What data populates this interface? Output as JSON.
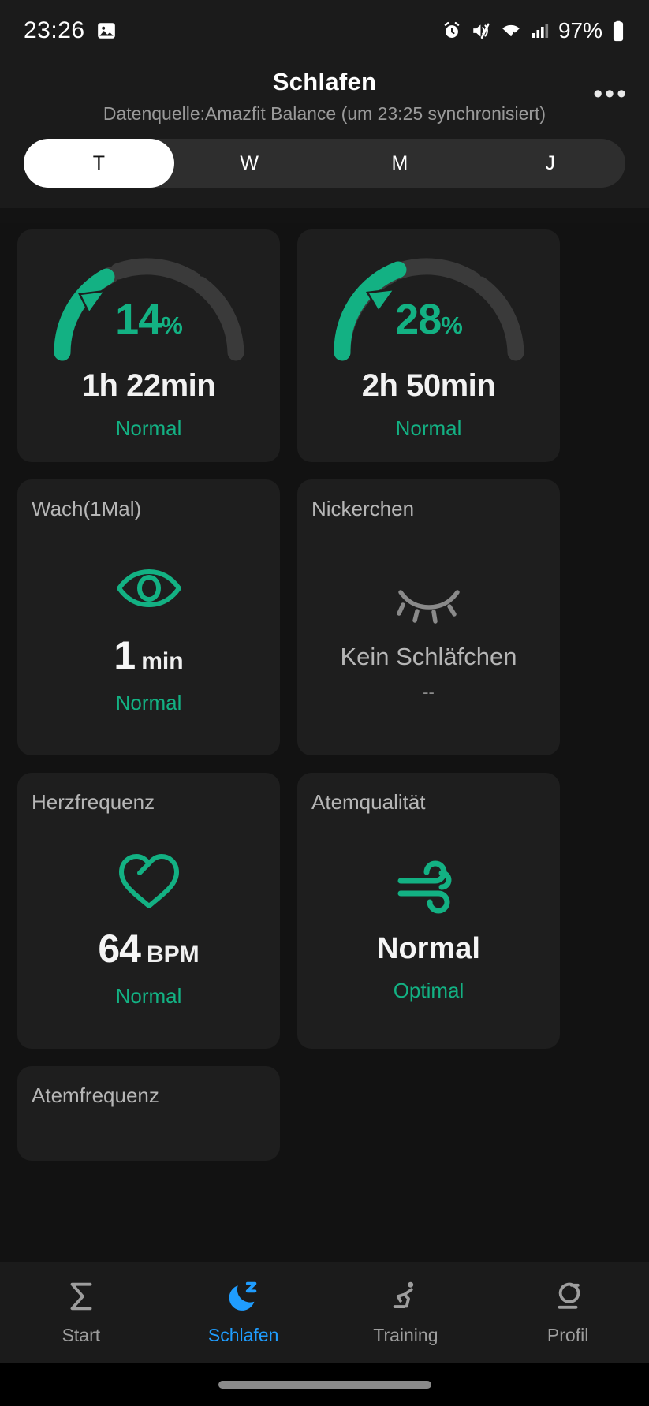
{
  "status_bar": {
    "time": "23:26",
    "battery_percent": "97%",
    "icons": [
      "image-icon",
      "alarm-icon",
      "mute-icon",
      "wifi-icon",
      "signal-icon",
      "battery-icon"
    ]
  },
  "header": {
    "title": "Schlafen",
    "subtitle": "Datenquelle:Amazfit Balance (um 23:25 synchronisiert)",
    "more_label": "•••"
  },
  "period_tabs": {
    "items": [
      {
        "label": "T",
        "active": true
      },
      {
        "label": "W",
        "active": false
      },
      {
        "label": "M",
        "active": false
      },
      {
        "label": "J",
        "active": false
      }
    ]
  },
  "colors": {
    "accent_green": "#13b183",
    "accent_blue": "#1f9dff",
    "card_bg": "#1e1e1e",
    "track_gray": "#3a3a3a"
  },
  "cards": {
    "deep_sleep": {
      "percent": "14",
      "percent_unit": "%",
      "percent_value": 14,
      "duration": "1h 22min",
      "status": "Normal"
    },
    "light_sleep": {
      "percent": "28",
      "percent_unit": "%",
      "percent_value": 28,
      "duration": "2h 50min",
      "status": "Normal"
    },
    "awake": {
      "title": "Wach(1Mal)",
      "icon": "eye-open-icon",
      "value": "1",
      "unit": "min",
      "status": "Normal"
    },
    "nap": {
      "title": "Nickerchen",
      "icon": "eye-closed-icon",
      "value": "Kein Schläfchen",
      "status": "--"
    },
    "heart_rate": {
      "title": "Herzfrequenz",
      "icon": "heart-icon",
      "value": "64",
      "unit": "BPM",
      "status": "Normal"
    },
    "breathing_quality": {
      "title": "Atemqualität",
      "icon": "wind-icon",
      "value": "Normal",
      "status": "Optimal"
    },
    "breathing_rate": {
      "title": "Atemfrequenz"
    }
  },
  "bottom_nav": {
    "items": [
      {
        "label": "Start",
        "icon": "sigma-icon",
        "active": false
      },
      {
        "label": "Schlafen",
        "icon": "moon-sleep-icon",
        "active": true
      },
      {
        "label": "Training",
        "icon": "runner-icon",
        "active": false
      },
      {
        "label": "Profil",
        "icon": "profile-sigma-icon",
        "active": false
      }
    ]
  }
}
